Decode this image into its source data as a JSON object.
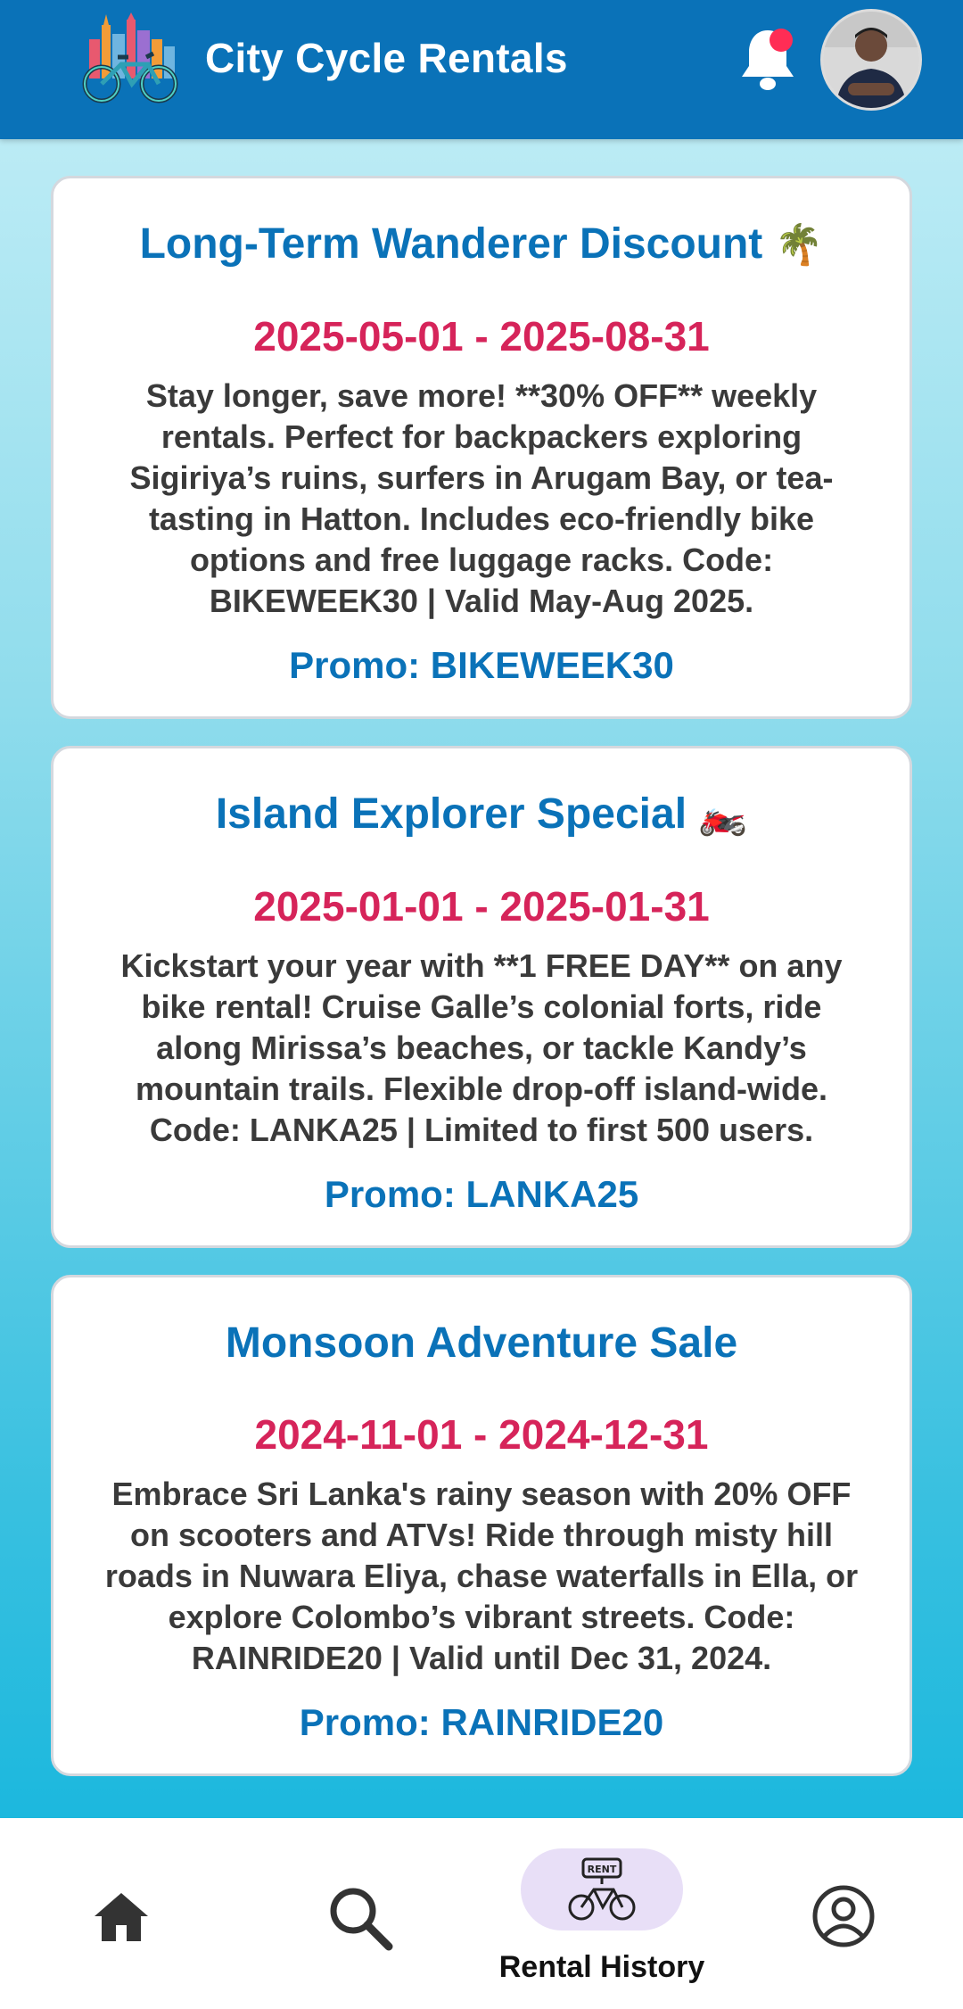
{
  "header": {
    "title": "City Cycle Rentals",
    "logo_icon": "city-bicycle-logo",
    "notification_icon": "bell-icon",
    "avatar_icon": "user-avatar"
  },
  "promotions": [
    {
      "title": "Long-Term Wanderer Discount",
      "emoji": "🌴",
      "dates": "2025-05-01 - 2025-08-31",
      "description": "Stay longer, save more! **30% OFF** weekly rentals. Perfect for backpackers exploring Sigiriya’s ruins, surfers in Arugam Bay, or tea-tasting in Hatton. Includes eco-friendly bike options and free luggage racks. Code: BIKEWEEK30 | Valid May-Aug 2025.",
      "promo": "Promo: BIKEWEEK30"
    },
    {
      "title": "Island Explorer Special",
      "emoji": "🏍️",
      "dates": "2025-01-01 - 2025-01-31",
      "description": "Kickstart your year with **1 FREE DAY** on any bike rental! Cruise Galle’s colonial forts, ride along Mirissa’s beaches, or tackle Kandy’s mountain trails. Flexible drop-off island-wide. Code: LANKA25 | Limited to first 500 users.",
      "promo": "Promo: LANKA25"
    },
    {
      "title": "Monsoon Adventure Sale",
      "emoji": "",
      "dates": "2024-11-01 - 2024-12-31",
      "description": "Embrace Sri Lanka's rainy season with 20% OFF on scooters and ATVs! Ride through misty hill roads in Nuwara Eliya, chase waterfalls in Ella, or explore Colombo’s vibrant streets. Code: RAINRIDE20 | Valid until Dec 31, 2024.",
      "promo": "Promo: RAINRIDE20"
    }
  ],
  "nav": {
    "active_label": "Rental History",
    "rent_badge": "RENT",
    "items": [
      {
        "icon": "home-icon"
      },
      {
        "icon": "search-icon"
      },
      {
        "icon": "rent-bike-icon"
      },
      {
        "icon": "profile-icon"
      }
    ]
  },
  "colors": {
    "header": "#0a72b8",
    "accent_title": "#0a72b8",
    "dates": "#d6245a",
    "notification_dot": "#ff2d55",
    "active_pill": "#e8dff7"
  }
}
